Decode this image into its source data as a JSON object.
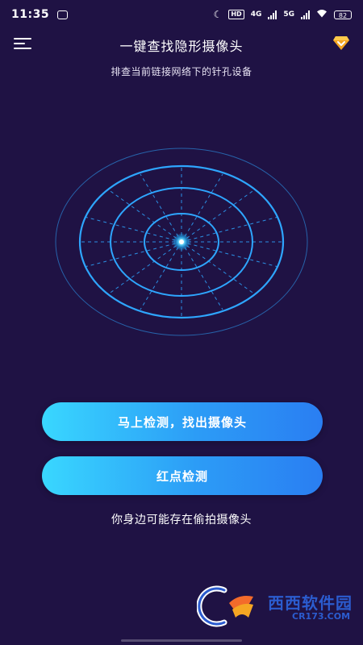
{
  "status_bar": {
    "time": "11:35",
    "network_hd": "HD",
    "network_4g": "4G",
    "network_5g": "5G",
    "battery": "82"
  },
  "header": {
    "title": "一键查找隐形摄像头"
  },
  "subtitle": "排查当前链接网络下的针孔设备",
  "buttons": {
    "primary": "马上检测，找出摄像头",
    "secondary": "红点检测"
  },
  "hint": "你身边可能存在偷拍摄像头",
  "watermark": {
    "text": "西西软件园",
    "sub": "CR173.COM"
  },
  "colors": {
    "background": "#1f1244",
    "button_start": "#39d7ff",
    "button_end": "#2a7ef2",
    "radar": "#2ea6ff",
    "vip": "#f5a623"
  }
}
